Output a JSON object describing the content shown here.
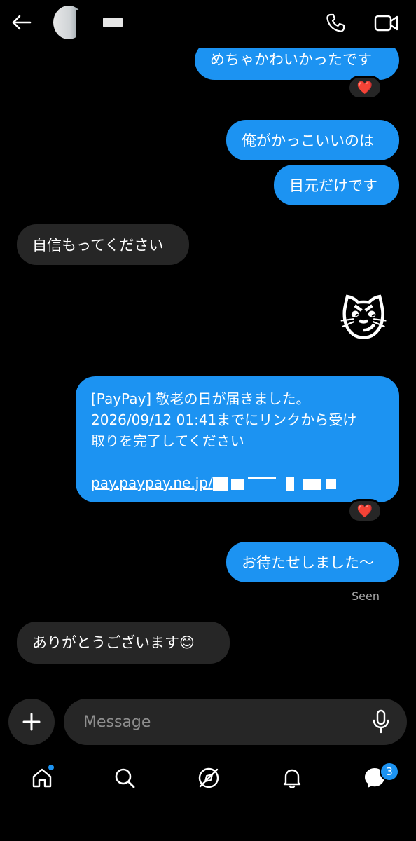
{
  "header": {
    "back_icon": "arrow-left-icon",
    "call_icon": "phone-icon",
    "video_icon": "video-camera-icon"
  },
  "messages": [
    {
      "direction": "outgoing",
      "text": "めちゃかわいかったです",
      "reaction": "❤️"
    },
    {
      "direction": "outgoing",
      "text": "俺がかっこいいのは"
    },
    {
      "direction": "outgoing",
      "text": "目元だけです"
    },
    {
      "direction": "incoming",
      "text": "自信もってください"
    },
    {
      "direction": "outgoing",
      "emoji": "😼"
    },
    {
      "direction": "outgoing",
      "lines": [
        "[PayPay] 敬老の日が届きました。",
        "2026/09/12 01:41までにリンクから受け",
        "取りを完了してください"
      ],
      "link": "pay.paypay.ne.jp/",
      "reaction": "❤️"
    },
    {
      "direction": "outgoing",
      "text": "お待たせしました〜"
    },
    {
      "direction": "incoming",
      "text": "ありがとうございます😊"
    }
  ],
  "status": {
    "seen": "Seen"
  },
  "composer": {
    "placeholder": "Message",
    "plus_icon": "plus-icon",
    "mic_icon": "microphone-icon"
  },
  "tabbar": {
    "items": [
      "home-icon",
      "search-icon",
      "explore-icon",
      "notifications-icon",
      "messages-icon"
    ],
    "messages_badge": "3"
  },
  "colors": {
    "outgoing_bubble": "#1c93f2",
    "incoming_bubble": "#262626",
    "background": "#000000"
  }
}
